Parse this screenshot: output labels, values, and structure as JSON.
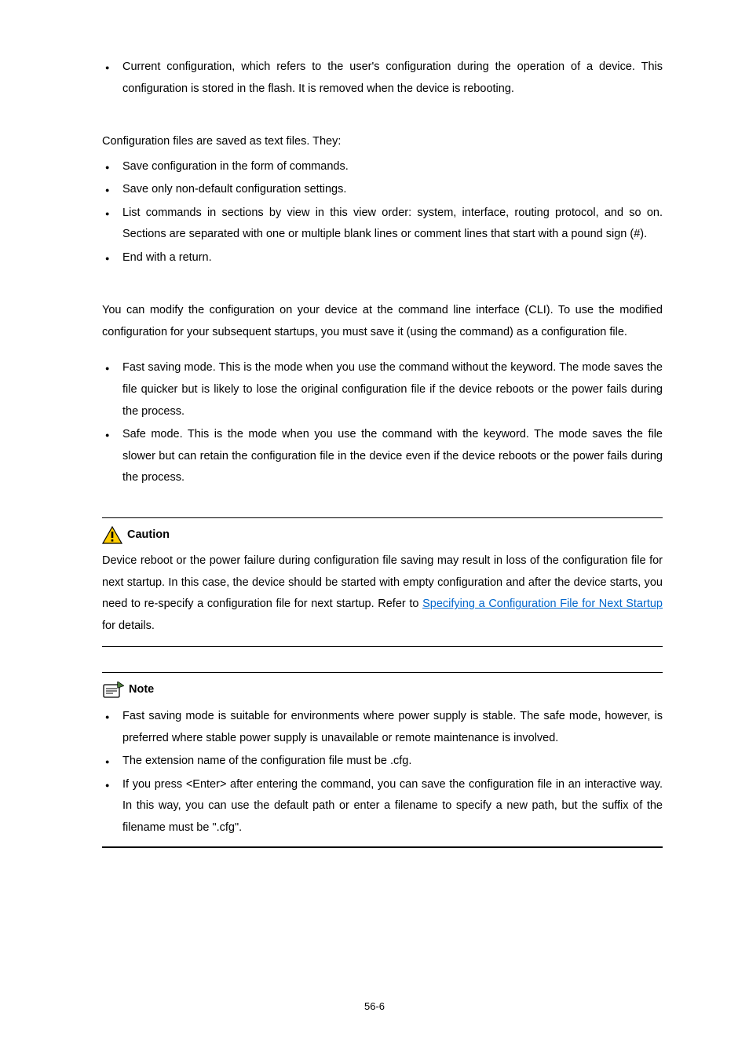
{
  "top_bullet": "Current configuration, which refers to the user's configuration during the operation of a device. This configuration is stored in the flash. It is removed when the device is rebooting.",
  "cfg_intro": "Configuration files are saved as text files. They:",
  "cfg_bullets": [
    "Save configuration in the form of commands.",
    "Save only non-default configuration settings.",
    "List commands in sections by view in this view order: system, interface, routing protocol, and so on. Sections are separated with one or multiple blank lines or comment lines that start with a pound sign (#).",
    "End with a return."
  ],
  "modify_para": "You can modify the configuration on your device at the command line interface (CLI). To use the modified configuration for your subsequent startups, you must save it (using the        command) as a configuration file.",
  "mode_bullets": [
    "Fast saving mode. This is the mode when you use the        command without the          keyword. The mode saves the file quicker but is likely to lose the original configuration file if the device reboots or the power fails during the process.",
    "Safe mode. This is the mode when you use the       command with the          keyword. The mode saves the file slower but can retain the configuration file in the device even if the device reboots or the power fails during the process."
  ],
  "caution": {
    "label": "Caution",
    "body_before_link": "Device reboot or the power failure during configuration file saving may result in loss of the configuration file for next startup. In this case, the device should be started with empty configuration and after the device starts, you need to re-specify a configuration file for next startup. Refer to ",
    "link_text": "Specifying a Configuration File for Next Startup",
    "body_after_link": " for details."
  },
  "note": {
    "label": "Note",
    "bullets": [
      "Fast saving mode is suitable for environments where power supply is stable. The safe mode, however, is preferred where stable power supply is unavailable or remote maintenance is involved.",
      "The extension name of the configuration file must be .cfg.",
      "If you press <Enter> after entering the        command, you can save the configuration file in an interactive way. In this way, you can use the default path or enter a filename to specify a new path, but the suffix of the filename must be \".cfg\"."
    ]
  },
  "page_number": "56-6"
}
